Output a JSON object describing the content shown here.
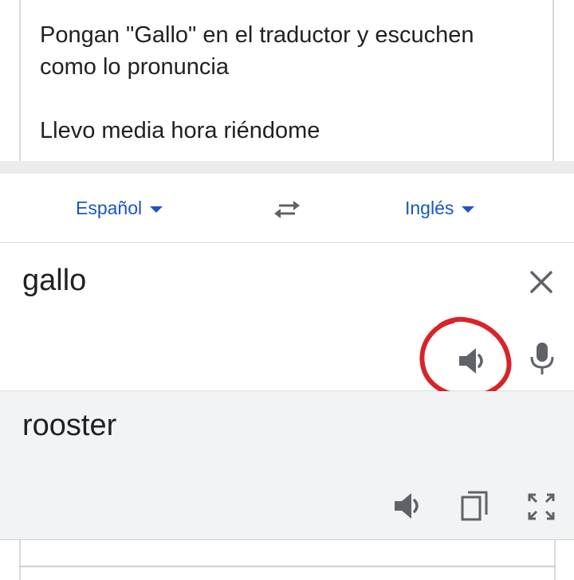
{
  "post": {
    "line1": "Pongan \"Gallo\" en el traductor y escuchen",
    "line2": "como lo pronuncia",
    "line3": "Llevo media hora riéndome"
  },
  "translator": {
    "source_lang": "Español",
    "target_lang": "Inglés",
    "input_text": "gallo",
    "output_text": "rooster",
    "highlight_color": "#d9232a",
    "link_color": "#1a56c0",
    "icons": [
      "swap-icon",
      "close-icon",
      "speaker-icon",
      "mic-icon",
      "copy-icon",
      "fullscreen-icon"
    ]
  }
}
